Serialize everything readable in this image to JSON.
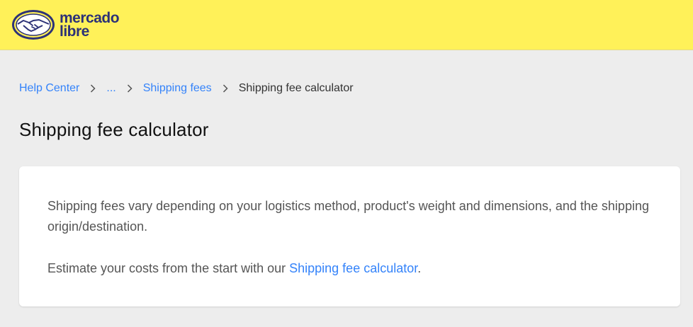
{
  "header": {
    "logo_line1": "mercado",
    "logo_line2": "libre",
    "brand_colors": {
      "header_bg": "#fff159",
      "logo_text": "#2d3277",
      "link": "#3483fa"
    },
    "logo_icon": "handshake-icon"
  },
  "breadcrumb": {
    "items": [
      {
        "label": "Help Center"
      },
      {
        "label": "..."
      },
      {
        "label": "Shipping fees"
      },
      {
        "label": "Shipping fee calculator"
      }
    ],
    "separator_icon": "chevron-right-icon"
  },
  "page": {
    "title": "Shipping fee calculator"
  },
  "card": {
    "paragraph1": "Shipping fees vary depending on your logistics method, product's weight and dimensions, and the shipping origin/destination.",
    "paragraph2_prefix": "Estimate your costs from the start with our ",
    "paragraph2_link": "Shipping fee calculator",
    "paragraph2_suffix": "."
  }
}
